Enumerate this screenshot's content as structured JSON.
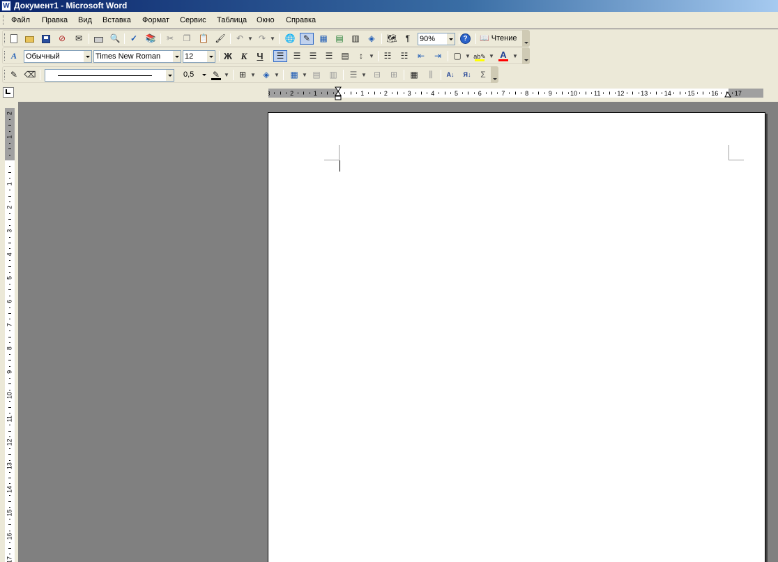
{
  "window": {
    "title": "Документ1 - Microsoft Word"
  },
  "menu": [
    "Файл",
    "Правка",
    "Вид",
    "Вставка",
    "Формат",
    "Сервис",
    "Таблица",
    "Окно",
    "Справка"
  ],
  "standard_toolbar": {
    "zoom": "90%",
    "reading_mode_label": "Чтение",
    "paragraph_mark": "¶",
    "help": "?"
  },
  "formatting_toolbar": {
    "style": "Обычный",
    "font": "Times New Roman",
    "size": "12",
    "bold": "Ж",
    "italic": "К",
    "underline": "Ч",
    "font_color": "#ff0000",
    "highlight_color": "#ffff00"
  },
  "tables_toolbar": {
    "line_weight": "0,5",
    "sum": "Σ"
  },
  "hruler": {
    "left_numbers": [
      "3",
      "2",
      "1"
    ],
    "right_numbers": [
      "1",
      "2",
      "3",
      "4",
      "5",
      "6",
      "7",
      "8",
      "9",
      "10",
      "11",
      "12",
      "13",
      "14",
      "15",
      "16",
      "17"
    ]
  },
  "vruler": {
    "top_numbers": [
      "2",
      "1"
    ],
    "numbers": [
      "1",
      "2",
      "3",
      "4",
      "5",
      "6",
      "7",
      "8",
      "9",
      "10",
      "11",
      "12",
      "13",
      "14",
      "15",
      "16",
      "17"
    ]
  },
  "colors": {
    "title_bar": "#0a246a",
    "workspace": "#808080",
    "toolbar": "#ece9d8"
  }
}
